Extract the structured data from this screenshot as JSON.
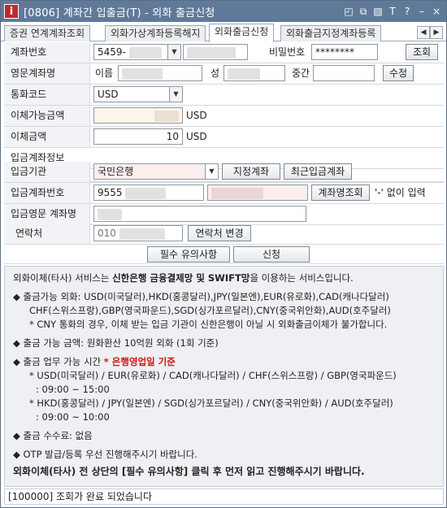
{
  "window": {
    "icon_text": "i",
    "title": "[0806] 계좌간 입출금(T) - 외화 출금신청",
    "controls": [
      "◰",
      "⧉",
      "▨",
      "T",
      "?",
      "–",
      "×"
    ]
  },
  "tabs": [
    {
      "label": "증권 연계계좌조회",
      "active": false
    },
    {
      "label": "외화가상계좌등록해지",
      "active": false
    },
    {
      "label": "외화출금신청",
      "active": true
    },
    {
      "label": "외화출금지정계좌등록",
      "active": false
    }
  ],
  "tab_scroll": {
    "prev": "◀",
    "next": "▶"
  },
  "form": {
    "account": {
      "label": "계좌번호",
      "value": "5459-",
      "password_label": "비밀번호",
      "password_value": "********",
      "query_button": "조회"
    },
    "eng_name": {
      "label": "영문계좌명",
      "first_name_label": "이름",
      "last_name_label": "성",
      "middle_name_label": "중간",
      "edit_button": "수정"
    },
    "currency": {
      "label": "통화코드",
      "value": "USD"
    },
    "available": {
      "label": "이체가능금액",
      "value": "",
      "unit": "USD"
    },
    "amount": {
      "label": "이체금액",
      "value": "10",
      "unit": "USD"
    },
    "section_title": "입금계좌정보",
    "bank": {
      "label": "입금기관",
      "value": "국민은행",
      "designated_button": "지정계좌",
      "recent_button": "최근입금계좌"
    },
    "deposit_account": {
      "label": "입금계좌번호",
      "value": "9555",
      "name_query_button": "계좌명조회",
      "hint": "'-' 없이 입력"
    },
    "deposit_eng_name": {
      "label": "입금영문 계좌명"
    },
    "contact": {
      "label": "연락처",
      "value": "010",
      "change_button": "연락처 변경"
    }
  },
  "actions": {
    "notice_button": "필수 유의사항",
    "apply_button": "신청"
  },
  "notice": {
    "intro_a": "외화이체(타사) 서비스는 ",
    "intro_b": "신한은행 금융결제망 및 SWIFT망",
    "intro_c": "을 이용하는 서비스입니다.",
    "cur1": "◆ 출금가능 외화: USD(미국달러),HKD(홍콩달러),JPY(일본엔),EUR(유로화),CAD(캐나다달러)",
    "cur2": "CHF(스위스프랑),GBP(영국파운드),SGD(싱가포르달러),CNY(중국위안화),AUD(호주달러)",
    "cny": "* CNY 통화의 경우, 이체 받는 입금 기관이 신한은행이 아닐 시 외화출금이체가 불가합니다.",
    "limit": "◆ 출금 가능 금액: 원화환산 10억원 외화 (1회 기준)",
    "hours_a": "◆ 출금 업무 가능 시간  ",
    "hours_b": "* 은행영업일 기준",
    "grp1a": "* USD(미국달러) / EUR(유로화) / CAD(캐나다달러) / CHF(스위스프랑) / GBP(영국파운드)",
    "grp1b": ": 09:00 ~ 15:00",
    "grp2a": "* HKD(홍콩달러) / JPY(일본엔) / SGD(싱가포르달러) / CNY(중국위안화) / AUD(호주달러)",
    "grp2b": ": 09:00 ~ 10:00",
    "fee": "◆ 출금 수수료: 없음",
    "otp": "◆ OTP 발급/등록 우선 진행해주시기 바랍니다.",
    "final": "외화이체(타사) 전 상단의 [필수 유의사항] 클릭 후 먼저 읽고 진행해주시기 바랍니다."
  },
  "status": "[100000] 조회가 완료 되었습니다"
}
